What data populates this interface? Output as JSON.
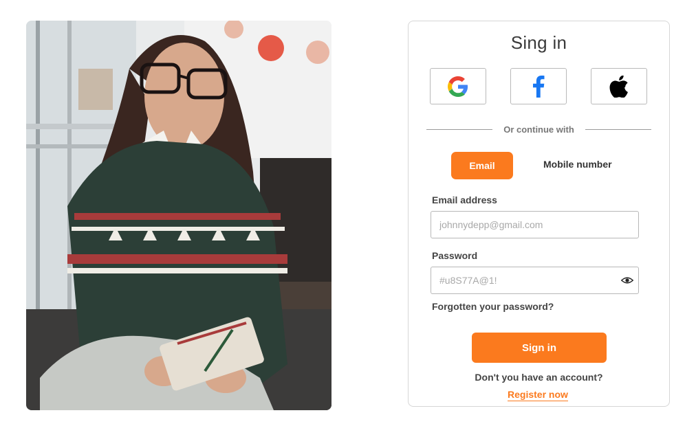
{
  "title": "Sing in",
  "social": {
    "google_icon": "google-icon",
    "facebook_icon": "facebook-icon",
    "apple_icon": "apple-icon"
  },
  "divider_text": "Or continue with",
  "tabs": {
    "email": "Email",
    "mobile": "Mobile number",
    "active": "Email"
  },
  "form": {
    "email_label": "Email address",
    "email_placeholder": "johnnydepp@gmail.com",
    "password_label": "Password",
    "password_placeholder": "#u8S77A@1!",
    "eye_icon": "eye-icon",
    "forgot": "Forgotten your password?",
    "submit": "Sign in"
  },
  "footer": {
    "question": "Don't you have an account?",
    "register": "Register now"
  },
  "colors": {
    "accent": "#fb7a1e",
    "border": "#d6d6d6"
  }
}
